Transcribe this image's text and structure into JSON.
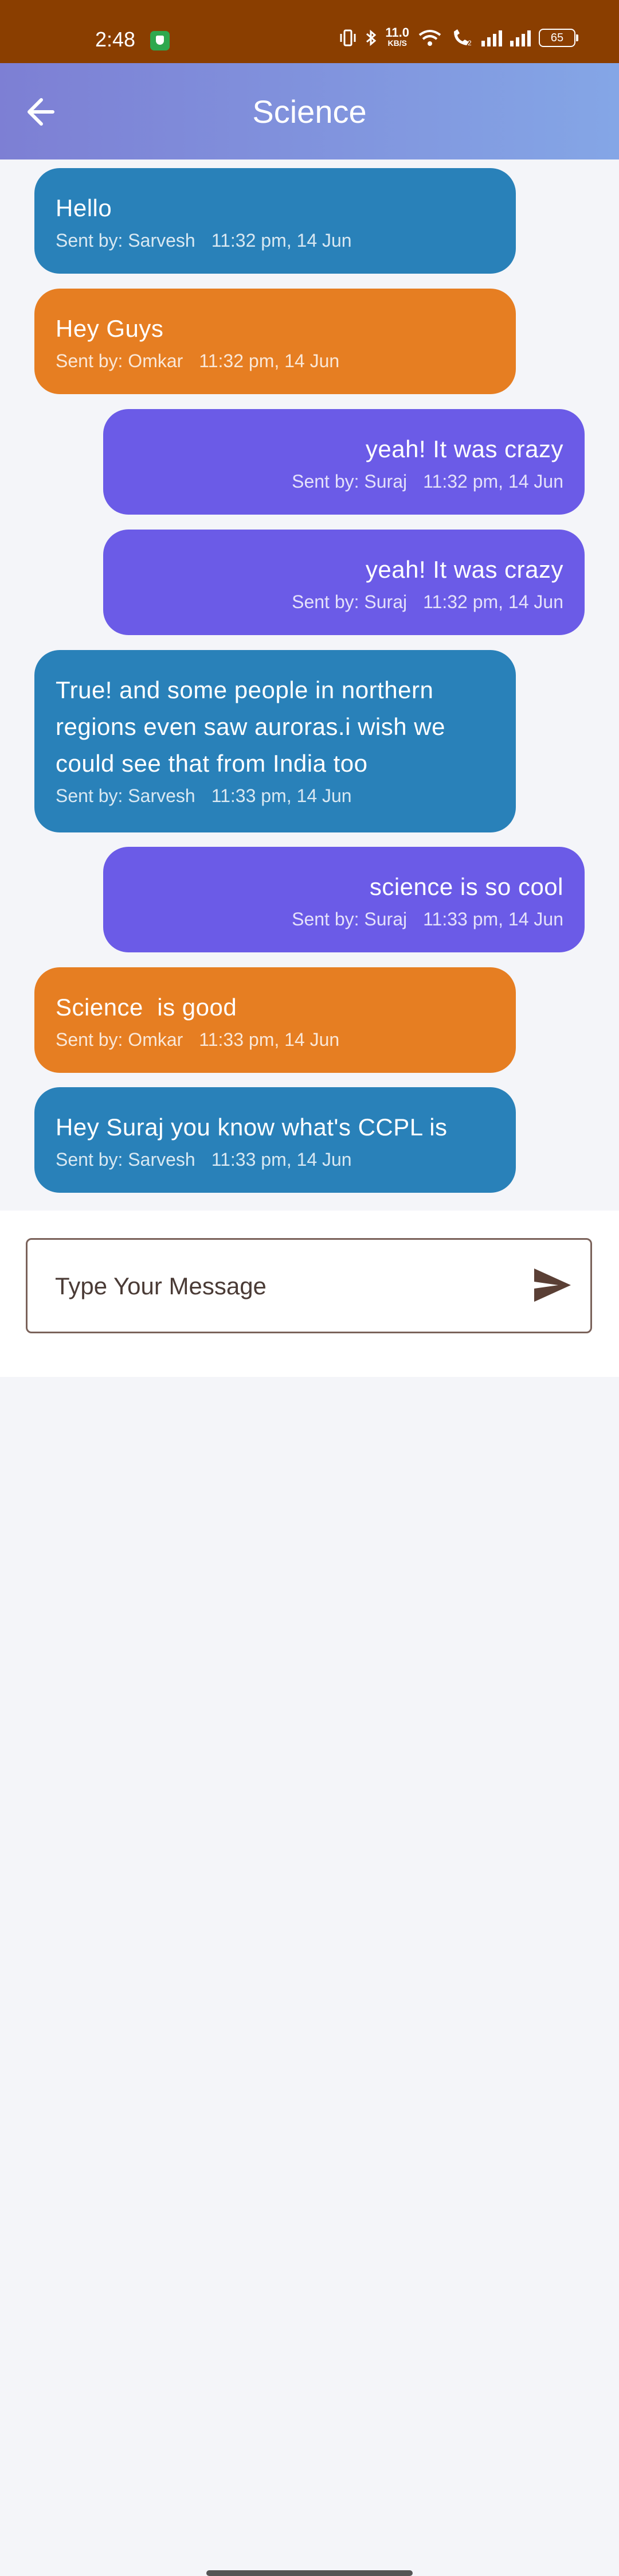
{
  "status_bar": {
    "time": "2:48",
    "net_speed": "11.0",
    "net_unit": "KB/S",
    "battery": "65"
  },
  "app_bar": {
    "title": "Science"
  },
  "messages": [
    {
      "text": "Hello",
      "sender_label": "Sent by: Sarvesh",
      "time": "11:32 pm, 14 Jun",
      "align": "left",
      "color": "#2981b9"
    },
    {
      "text": "Hey Guys",
      "sender_label": "Sent by: Omkar",
      "time": "11:32 pm, 14 Jun",
      "align": "left",
      "color": "#e67e22"
    },
    {
      "text": "yeah! It was crazy",
      "sender_label": "Sent by: Suraj",
      "time": "11:32 pm, 14 Jun",
      "align": "right",
      "color": "#6b5be7"
    },
    {
      "text": "yeah! It was crazy",
      "sender_label": "Sent by: Suraj",
      "time": "11:32 pm, 14 Jun",
      "align": "right",
      "color": "#6b5be7"
    },
    {
      "text": "True! and some people in northern regions even saw auroras.i wish we could see that from India too",
      "sender_label": "Sent by: Sarvesh",
      "time": "11:33 pm, 14 Jun",
      "align": "left",
      "color": "#2981b9"
    },
    {
      "text": "science is so cool",
      "sender_label": "Sent by: Suraj",
      "time": "11:33 pm, 14 Jun",
      "align": "right",
      "color": "#6b5be7"
    },
    {
      "text": "Science  is good",
      "sender_label": "Sent by: Omkar",
      "time": "11:33 pm, 14 Jun",
      "align": "left",
      "color": "#e67e22"
    },
    {
      "text": "Hey Suraj you know what's CCPL is",
      "sender_label": "Sent by: Sarvesh",
      "time": "11:33 pm, 14 Jun",
      "align": "left",
      "color": "#2981b9"
    }
  ],
  "composer": {
    "placeholder": "Type Your Message"
  },
  "icons": {
    "back": "arrow-left-icon",
    "send": "send-icon"
  },
  "colors": {
    "status_bar": "#8a3e00",
    "app_bar_start": "#7d7fd4",
    "app_bar_end": "#84a6e6",
    "blue_bubble": "#2981b9",
    "orange_bubble": "#e67e22",
    "purple_bubble": "#6b5be7"
  }
}
